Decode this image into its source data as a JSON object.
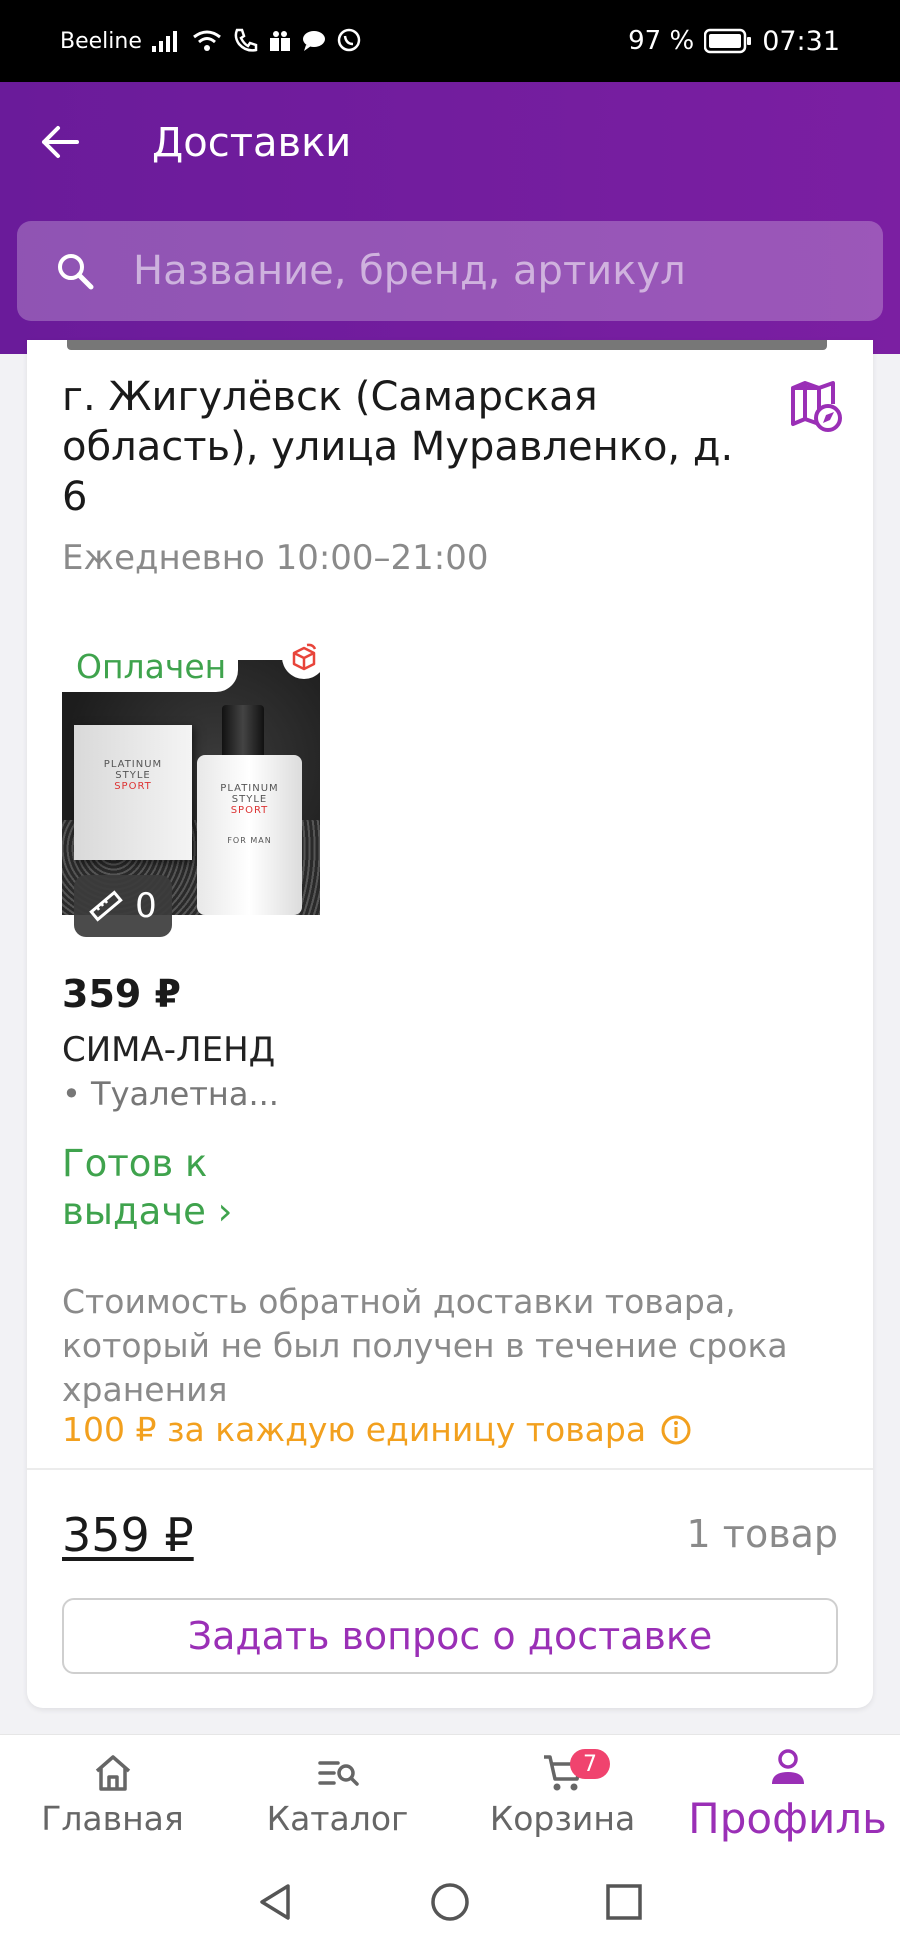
{
  "status_bar": {
    "carrier": "Beeline",
    "battery": "97 %",
    "time": "07:31"
  },
  "header": {
    "title": "Доставки",
    "search_placeholder": "Название, бренд, артикул"
  },
  "delivery": {
    "address": "г. Жигулёвск (Самарская область), улица Муравленко, д. 6",
    "hours": "Ежедневно 10:00–21:00",
    "product": {
      "paid_badge": "Оплачен",
      "size_count": "0",
      "price": "359 ₽",
      "brand": "СИМА-ЛЕНД",
      "description": "• Туалетна...",
      "status": "Готов к выдаче ›",
      "image_text": {
        "line1": "PLATINUM",
        "line2": "STYLE",
        "line3": "SPORT",
        "line4": "FOR MAN"
      }
    },
    "notice": "Стоимость обратной доставки товара, который не был получен в течение срока хранения",
    "fee": "100 ₽ за каждую единицу товара",
    "total": "359 ₽",
    "items_count": "1 товар",
    "ask_button": "Задать вопрос о доставке"
  },
  "bottom_nav": {
    "items": [
      {
        "label": "Главная",
        "icon": "home-icon"
      },
      {
        "label": "Каталог",
        "icon": "catalog-icon"
      },
      {
        "label": "Корзина",
        "icon": "cart-icon",
        "badge": "7"
      },
      {
        "label": "Профиль",
        "icon": "profile-icon",
        "active": true
      }
    ]
  },
  "colors": {
    "brand_purple": "#7b1fa2",
    "accent_purple": "#9a2fb6",
    "success_green": "#3fa34d",
    "warning_orange": "#f2a01e",
    "badge_pink": "#f0436e"
  }
}
